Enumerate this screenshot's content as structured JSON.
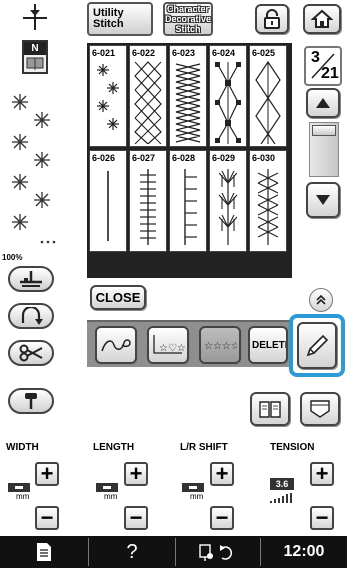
{
  "tabs": {
    "utility_line1": "Utility",
    "utility_line2": "Stitch",
    "character_line1": "Character",
    "character_line2": "Decorative",
    "character_line3": "Stitch"
  },
  "presser_foot": {
    "letter": "N"
  },
  "zoom": "100%",
  "stitches": [
    {
      "code": "6-021",
      "pattern": "stars"
    },
    {
      "code": "6-022",
      "pattern": "lattice"
    },
    {
      "code": "6-023",
      "pattern": "zigzag-chain"
    },
    {
      "code": "6-024",
      "pattern": "hourglass"
    },
    {
      "code": "6-025",
      "pattern": "diamonds"
    },
    {
      "code": "6-026",
      "pattern": "straight-line"
    },
    {
      "code": "6-027",
      "pattern": "ladder"
    },
    {
      "code": "6-028",
      "pattern": "comb"
    },
    {
      "code": "6-029",
      "pattern": "leaves"
    },
    {
      "code": "6-030",
      "pattern": "crosses"
    }
  ],
  "pagination": {
    "current": "3",
    "total": "21"
  },
  "buttons": {
    "close": "CLOSE",
    "delete": "DELETE"
  },
  "settings": {
    "width": {
      "label": "WIDTH",
      "unit": "mm"
    },
    "length": {
      "label": "LENGTH",
      "unit": "mm"
    },
    "lr_shift": {
      "label": "L/R SHIFT",
      "unit": "mm"
    },
    "tension": {
      "label": "TENSION",
      "value": "3.6"
    }
  },
  "status": {
    "help": "?",
    "time": "12:00"
  },
  "colors": {
    "highlight": "#2d9ad8",
    "status_bar": "#111111",
    "tray": "#8f8f8f"
  }
}
